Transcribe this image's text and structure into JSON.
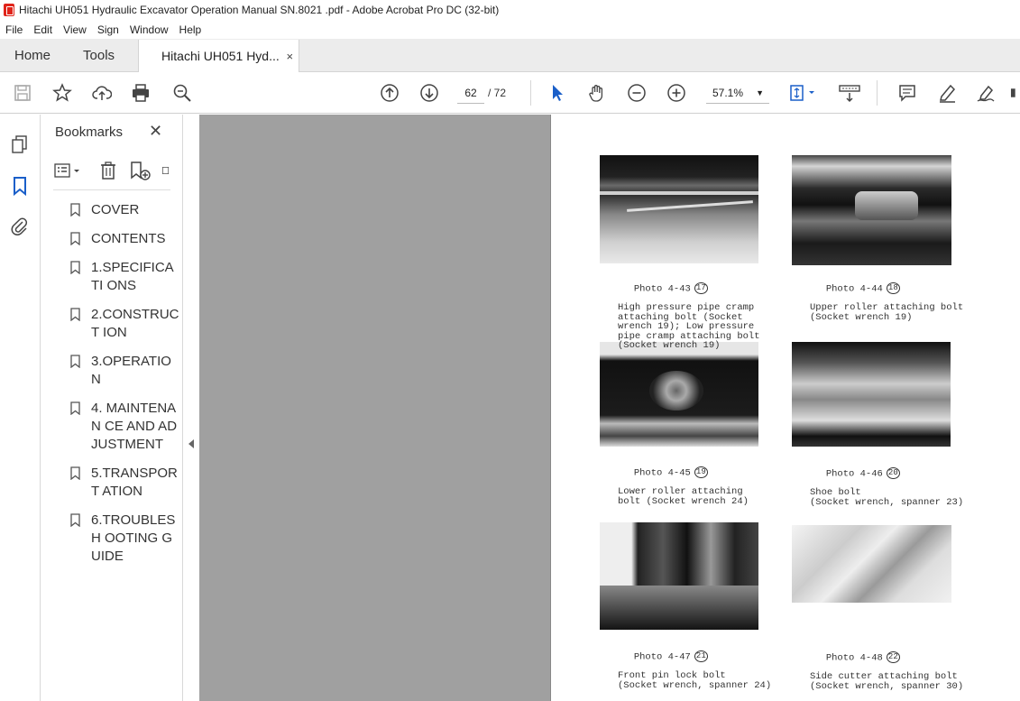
{
  "window": {
    "title": "Hitachi UH051 Hydraulic Excavator Operation Manual SN.8021 .pdf - Adobe Acrobat Pro DC (32-bit)"
  },
  "menu": [
    "File",
    "Edit",
    "View",
    "Sign",
    "Window",
    "Help"
  ],
  "tabs": {
    "home": "Home",
    "tools": "Tools",
    "document": "Hitachi UH051 Hyd...",
    "close": "×"
  },
  "toolbar": {
    "page_current": "62",
    "page_total": "/ 72",
    "zoom": "57.1%"
  },
  "bookmarks": {
    "title": "Bookmarks",
    "close": "✕",
    "items": [
      {
        "label": "COVER"
      },
      {
        "label": "CONTENTS"
      },
      {
        "label": "1.SPECIFICATI ONS"
      },
      {
        "label": "2.CONSTRUCT ION"
      },
      {
        "label": "3.OPERATION"
      },
      {
        "label": "4. MAINTENAN CE AND ADJUSTMENT"
      },
      {
        "label": "5.TRANSPORT ATION"
      },
      {
        "label": "6.TROUBLESH OOTING GUIDE"
      }
    ]
  },
  "page": {
    "photos": [
      {
        "label": "Photo 4-43",
        "num": "17",
        "caption": "High pressure pipe cramp\nattaching bolt (Socket\nwrench 19); Low pressure\npipe cramp attaching bolt\n(Socket wrench 19)"
      },
      {
        "label": "Photo 4-44",
        "num": "18",
        "caption": "Upper roller attaching bolt\n(Socket wrench 19)"
      },
      {
        "label": "Photo 4-45",
        "num": "19",
        "caption": "Lower roller attaching\nbolt (Socket wrench 24)"
      },
      {
        "label": "Photo 4-46",
        "num": "20",
        "caption": "Shoe bolt\n(Socket wrench, spanner 23)"
      },
      {
        "label": "Photo 4-47",
        "num": "21",
        "caption": "Front pin lock bolt\n(Socket wrench, spanner 24)"
      },
      {
        "label": "Photo 4-48",
        "num": "22",
        "caption": "Side cutter attaching bolt\n(Socket wrench, spanner 30)"
      }
    ]
  }
}
